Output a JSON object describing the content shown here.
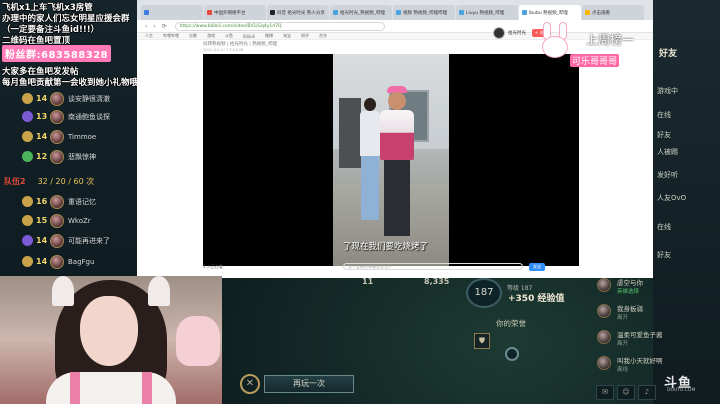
{
  "overlay": {
    "lines": [
      "飞机x1上车飞机x3房管",
      "办理中的家人们忘女明星应援会群",
      "（一定要备注斗鱼id!!!）",
      "二维码在鱼吧置顶"
    ],
    "fans_label": "粉丝群:683588328",
    "promo": [
      "大家多在鱼吧发发帖",
      "每月鱼吧贡献第一会收到她小礼物哦"
    ]
  },
  "team1": [
    {
      "level": "14",
      "name": "谈安静很清澈",
      "color": "#c9a24a"
    },
    {
      "level": "13",
      "name": "南通鲍鱼谈探",
      "color": "#7b5ad6"
    },
    {
      "level": "14",
      "name": "Timmoe",
      "color": "#c9a24a"
    },
    {
      "level": "12",
      "name": "悲飘惊神",
      "color": "#4bb35a"
    }
  ],
  "team2_header": {
    "label": "队伍2",
    "score": "32 / 20 / 60 次"
  },
  "team2": [
    {
      "level": "16",
      "name": "重语记忆",
      "color": "#c9a24a"
    },
    {
      "level": "15",
      "name": "WkoZr",
      "color": "#c9a24a"
    },
    {
      "level": "14",
      "name": "可能再进来了",
      "color": "#7b5ad6"
    },
    {
      "level": "14",
      "name": "BagFgu",
      "color": "#c9a24a"
    }
  ],
  "browser": {
    "tabs": [
      {
        "label": "",
        "color": "#3d7ae4",
        "active": false
      },
      {
        "label": "中国外网络平台",
        "color": "#e94b3c",
        "active": false
      },
      {
        "label": "抖音 拾光时光 熟人分享",
        "color": "#222",
        "active": false
      },
      {
        "label": "拾光时光_熟视频_哔哩",
        "color": "#4aa3df",
        "active": false
      },
      {
        "label": "视频 熟视频_哔哩哔哩",
        "color": "#4aa3df",
        "active": false
      },
      {
        "label": "Liuyu 熟视频_哔哩",
        "color": "#4aa3df",
        "active": false
      },
      {
        "label": "lbubu 熟视频_哔哩",
        "color": "#4aa3df",
        "active": true
      },
      {
        "label": "点击观看",
        "color": "#ffb400",
        "active": false
      }
    ],
    "address": "https://www.bilibili.com/video/BV1iGq4y1d7Q",
    "bookmarks": [
      "人生",
      "哔哩哔哩",
      "谷歌",
      "游戏",
      "斗鱼",
      "Bilibili",
      "微博",
      "淘宝",
      "知乎",
      "京东"
    ],
    "crumb": "抖转熟视频 | 拾光时光 | 熟视频_哔哩",
    "meta": "2021-04-17 17:14:06",
    "author": "拾光时光",
    "follow": "+ 关注",
    "subtitle": "了现在我们要吃烧烤了",
    "below": {
      "episode": "1 人正在看",
      "bullet_placeholder": "发个友善的弹幕见证当下",
      "send": "发送"
    }
  },
  "rank": {
    "title": "上周榜一",
    "sub": "可乐哥哥哥"
  },
  "right_panel": {
    "title": "好友",
    "items": [
      "游戏中",
      "在线",
      "好友",
      "人被踢",
      "发好听",
      "人友OvO",
      "在线",
      "好友"
    ]
  },
  "game": {
    "stats": [
      "11",
      "8,335"
    ],
    "level": "187",
    "level_info": "等级 187",
    "xp_gain": "+350 经验值",
    "honor": "你的荣誉",
    "replay": "再玩一次"
  },
  "chat": [
    {
      "name": "虐空与你",
      "status": "英雄选择",
      "green": true
    },
    {
      "name": "我身板弱",
      "status": "离开",
      "green": false
    },
    {
      "name": "温柔可爱鱼子酱",
      "status": "离开",
      "green": false
    },
    {
      "name": "叫我小天就好啊",
      "status": "离线",
      "green": false
    }
  ],
  "brand": {
    "name": "斗鱼",
    "sub": "DOUYU.COM"
  },
  "bottom_icons": [
    "消息",
    "好友",
    "语音"
  ]
}
